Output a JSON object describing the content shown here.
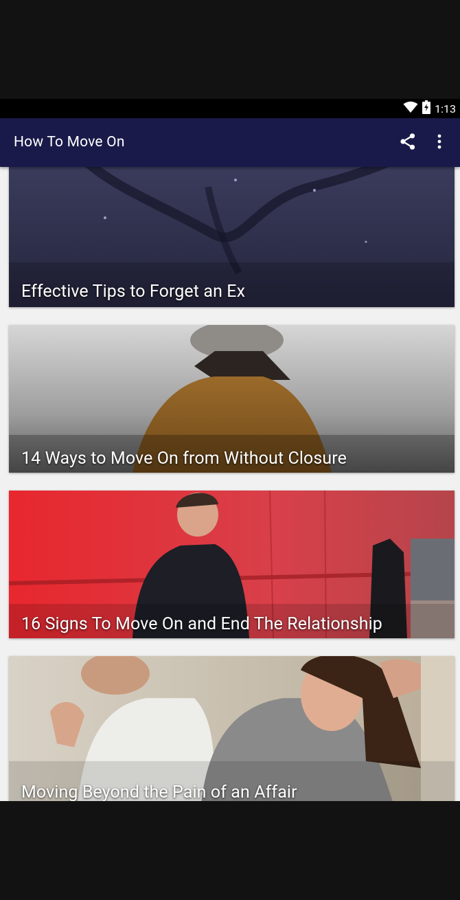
{
  "status_bar": {
    "time": "1:13",
    "wifi_icon": "wifi-icon",
    "battery_icon": "battery-icon"
  },
  "app_bar": {
    "title": "How To Move On",
    "share_icon": "share-icon",
    "more_icon": "more-vert-icon"
  },
  "articles": [
    {
      "title": "Effective Tips to Forget an Ex"
    },
    {
      "title": "14 Ways to Move On from Without Closure"
    },
    {
      "title": "16 Signs To Move On and End The Relationship"
    },
    {
      "title": "Moving Beyond the Pain of an Affair"
    }
  ],
  "colors": {
    "app_bar": "#1a1a4a",
    "status_bar": "#000000",
    "background": "#f1f1f1"
  }
}
